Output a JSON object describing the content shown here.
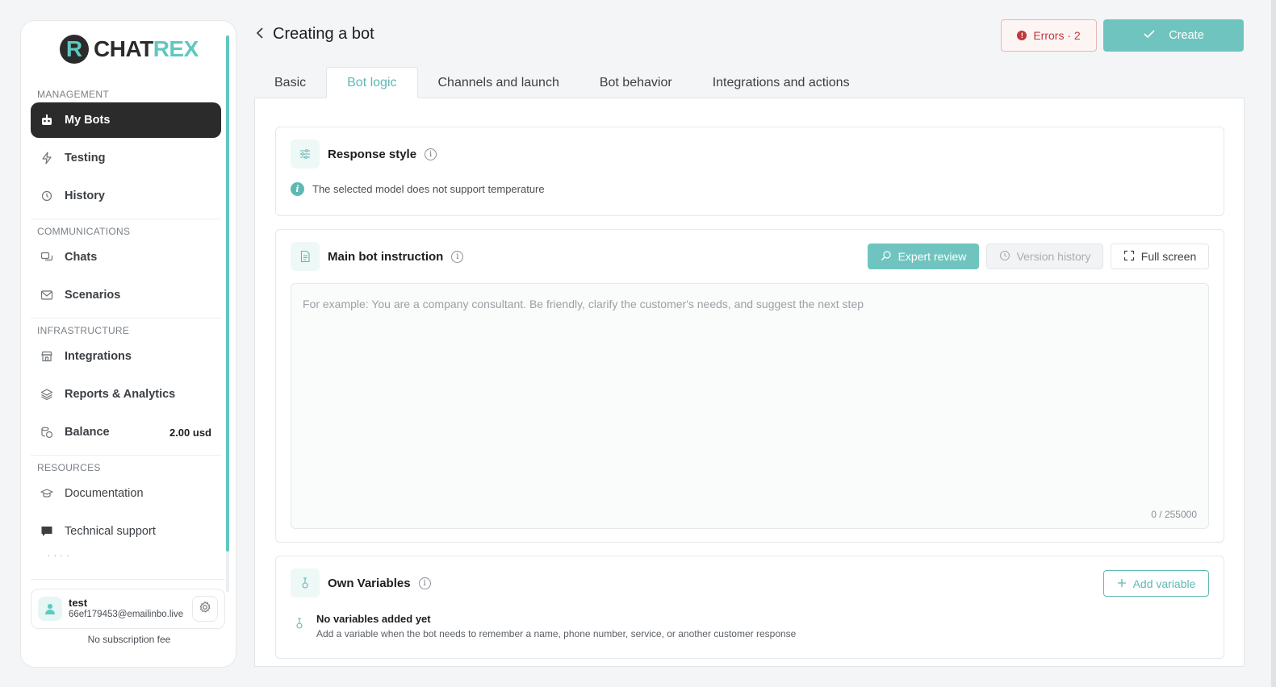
{
  "brand": {
    "letter": "R",
    "name_part1": "CHAT",
    "name_part2": "REX",
    "accent": "#5fc8c0",
    "dark": "#2b2b2b"
  },
  "sidebar": {
    "sections": {
      "management": "MANAGEMENT",
      "communications": "COMMUNICATIONS",
      "infrastructure": "INFRASTRUCTURE",
      "resources": "RESOURCES"
    },
    "items": {
      "my_bots": "My Bots",
      "testing": "Testing",
      "history": "History",
      "chats": "Chats",
      "scenarios": "Scenarios",
      "integrations": "Integrations",
      "reports": "Reports & Analytics",
      "balance": "Balance",
      "balance_value": "2.00 usd",
      "documentation": "Documentation",
      "support": "Technical support"
    },
    "user": {
      "name": "test",
      "email": "66ef179453@emailinbo.live"
    },
    "subscription": "No subscription fee"
  },
  "header": {
    "title": "Creating a bot",
    "errors_label": "Errors · 2",
    "create_label": "Create"
  },
  "tabs": [
    "Basic",
    "Bot logic",
    "Channels and launch",
    "Bot behavior",
    "Integrations and actions"
  ],
  "active_tab": "Bot logic",
  "response_style": {
    "title": "Response style",
    "note": "The selected model does not support temperature"
  },
  "instruction": {
    "title": "Main bot instruction",
    "expert_label": "Expert review",
    "version_label": "Version history",
    "fullscreen_label": "Full screen",
    "placeholder": "For example: You are a company consultant. Be friendly, clarify the customer's needs, and suggest the next step",
    "value": "",
    "counter": "0 / 255000"
  },
  "variables": {
    "title": "Own Variables",
    "add_label": "Add variable",
    "empty_title": "No variables added yet",
    "empty_desc": "Add a variable when the bot needs to remember a name, phone number, service, or another customer response"
  },
  "colors": {
    "teal": "#6fc4bf",
    "error": "#c0393b"
  }
}
